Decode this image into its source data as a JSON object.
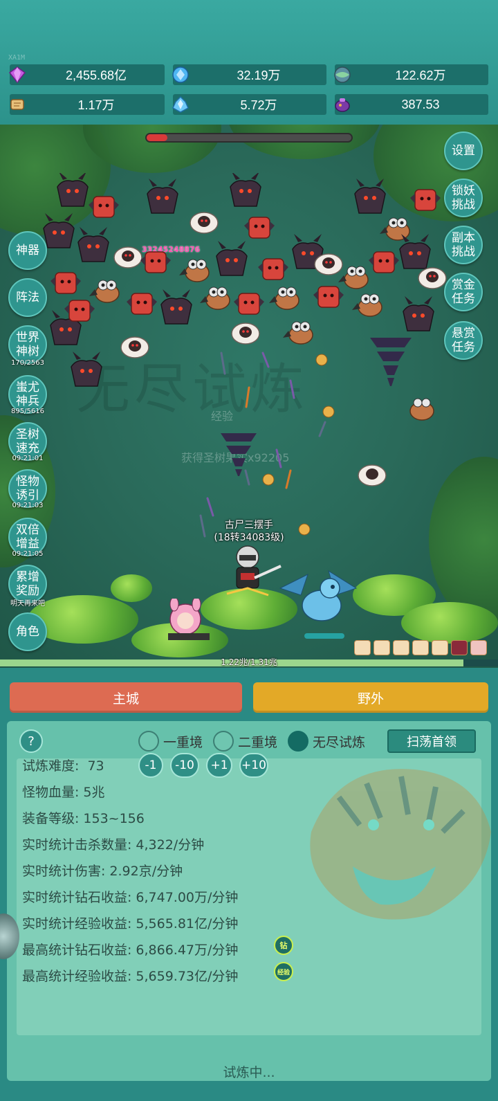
{
  "top": {
    "tag": "XA1M",
    "resources": [
      {
        "icon": "purple-diamond-icon",
        "value": "2,455.68亿"
      },
      {
        "icon": "blue-crystal-icon",
        "value": "32.19万"
      },
      {
        "icon": "globe-orb-icon",
        "value": "122.62万"
      },
      {
        "icon": "scroll-icon",
        "value": "1.17万"
      },
      {
        "icon": "ice-crystal-icon",
        "value": "5.72万"
      },
      {
        "icon": "purple-pot-icon",
        "value": "387.53"
      }
    ]
  },
  "field": {
    "boss_hp_fraction": 0.1,
    "damage_number": "33245248876",
    "watermark": "无尽试炼",
    "float_text_1": "经验",
    "float_text_2": "获得圣树果实x92205",
    "player_name": "古尸三摆手",
    "player_level": "(18转34083级)",
    "exp_text": "1.22兆/1.31兆",
    "exp_fraction": 0.93
  },
  "left_menu": [
    {
      "label": "神器",
      "caption": ""
    },
    {
      "label": "阵法",
      "caption": ""
    },
    {
      "label": "世界神树",
      "caption": "170/2563"
    },
    {
      "label": "蚩尤神兵",
      "caption": "895/5616"
    },
    {
      "label": "圣树速充",
      "caption": "09:21:01"
    },
    {
      "label": "怪物诱引",
      "caption": "09:21:03"
    },
    {
      "label": "双倍增益",
      "caption": "09:21:05"
    },
    {
      "label": "累增奖励",
      "caption": "明天再来吧"
    },
    {
      "label": "角色",
      "caption": ""
    }
  ],
  "right_menu": [
    {
      "label": "设置"
    },
    {
      "label": "锁妖挑战"
    },
    {
      "label": "副本挑战"
    },
    {
      "label": "赏金任务"
    },
    {
      "label": "悬赏任务"
    }
  ],
  "tabs": {
    "main_city": "主城",
    "wild": "野外"
  },
  "panel": {
    "help": "?",
    "modes": [
      "一重境",
      "二重境",
      "无尽试炼"
    ],
    "sweep": "扫荡首领",
    "difficulty_label": "试炼难度:",
    "difficulty_value": "73",
    "adjust": [
      "-1",
      "-10",
      "+1",
      "+10"
    ],
    "stats": [
      {
        "k": "怪物血量:",
        "v": "5兆"
      },
      {
        "k": "装备等级:",
        "v": "153~156"
      },
      {
        "k": "实时统计击杀数量:",
        "v": "4,322/分钟"
      },
      {
        "k": "实时统计伤害:",
        "v": "2.92京/分钟"
      },
      {
        "k": "实时统计钻石收益:",
        "v": "6,747.00万/分钟"
      },
      {
        "k": "实时统计经验收益:",
        "v": "5,565.81亿/分钟"
      },
      {
        "k": "最高统计钻石收益:",
        "v": "6,866.47万/分钟"
      },
      {
        "k": "最高统计经验收益:",
        "v": "5,659.73亿/分钟"
      }
    ],
    "badge_diamond": "钻",
    "badge_exp": "经验",
    "status": "试炼中..."
  },
  "colors": {
    "main_city": "#dd6b52",
    "wild": "#e3a927",
    "panel": "#66c1ab"
  }
}
